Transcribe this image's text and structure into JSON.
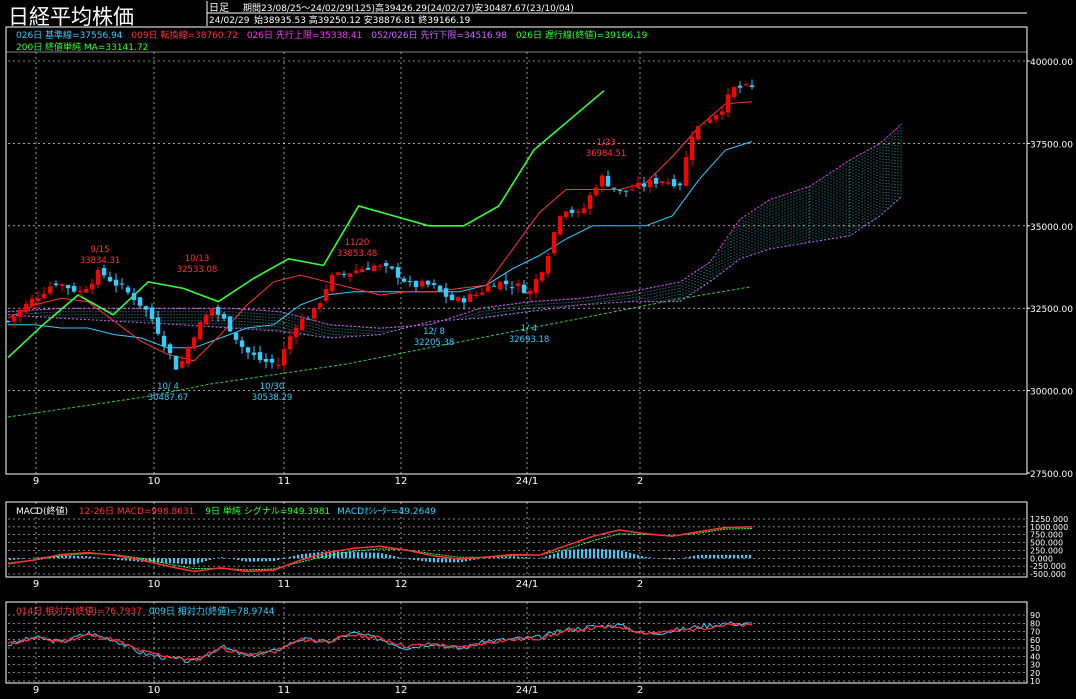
{
  "header": {
    "title": "日経平均株価",
    "mode": "日足",
    "period": "期間23/08/25〜24/02/29(125)高39426.29(24/02/27)安30487.67(23/10/04)",
    "date": "24/02/29",
    "ohlc": "始38935.53 高39250.12 安38876.81 終39166.19"
  },
  "legend_main": {
    "line1": [
      {
        "text": "026日 基準線=37556.94",
        "color": "#33ccff"
      },
      {
        "text": "009日 転換線=38760.72",
        "color": "#ff3333"
      },
      {
        "text": "026日 先行上限=35338.41",
        "color": "#ff33ff"
      },
      {
        "text": "052/026日 先行下限=34516.98",
        "color": "#cc66ff"
      },
      {
        "text": "026日 遅行線(終値)=39166.19",
        "color": "#33ff33"
      }
    ],
    "line2": [
      {
        "text": "200日 終値単純 MA=33141.72",
        "color": "#33ff33"
      }
    ]
  },
  "legend_macd": [
    {
      "text": "MACD(終値)",
      "color": "#ffffff"
    },
    {
      "text": "12-26日 MACD=998.8631",
      "color": "#ff3333"
    },
    {
      "text": "9日 単純 シグナル=949.3981",
      "color": "#33ff33"
    },
    {
      "text": "MACDｵｼﾚｰﾀｰ=49.2649",
      "color": "#33ccff"
    }
  ],
  "legend_rsi": [
    {
      "text": "014日 相対力(終値)=76.7937",
      "color": "#ff3333"
    },
    {
      "text": "009日 相対力(終値)=78.9744",
      "color": "#33ccff"
    }
  ],
  "annotations": [
    {
      "date": "9/15",
      "value": "33834.31",
      "color": "#ff3333"
    },
    {
      "date": "10/13",
      "value": "32533.08",
      "color": "#ff3333"
    },
    {
      "date": "11/20",
      "value": "33853.48",
      "color": "#ff3333"
    },
    {
      "date": "1/23",
      "value": "36984.51",
      "color": "#ff3333"
    },
    {
      "date": "10/ 4",
      "value": "30487.67",
      "color": "#33ccff"
    },
    {
      "date": "10/30",
      "value": "30538.29",
      "color": "#33ccff"
    },
    {
      "date": "12/ 8",
      "value": "32205.38",
      "color": "#33ccff"
    },
    {
      "date": "1/ 4",
      "value": "32693.18",
      "color": "#33ccff"
    }
  ],
  "colors": {
    "up": "#ff0000",
    "down": "#33ccff",
    "kijun": "#33ccff",
    "tenkan": "#ff3333",
    "chikou": "#33ff33",
    "ma200": "#33cc33",
    "cloud": "#cc66ff",
    "cloud_hatch": "#33cccc",
    "grid": "#ffffff",
    "frame": "#ffffff"
  },
  "chart_data": [
    {
      "type": "candlestick",
      "title": "日経平均株価",
      "x_ticks": [
        "9",
        "10",
        "11",
        "12",
        "24/1",
        "2"
      ],
      "y_ticks": [
        "27500.00",
        "30000.00",
        "32500.00",
        "35000.00",
        "37500.00",
        "40000.00"
      ],
      "ylim": [
        27500,
        40500
      ],
      "grid": true,
      "series": [
        {
          "name": "026日 基準線",
          "values": [
            32000,
            32000,
            31900,
            31900,
            31700,
            31600,
            31300,
            31300,
            31600,
            31900,
            32000,
            32600,
            32900,
            33000,
            33000,
            33000,
            33000,
            33000,
            33200,
            33700,
            34100,
            34600,
            35000,
            35000,
            35000,
            35300,
            36400,
            37300,
            37557
          ]
        },
        {
          "name": "009日 転換線",
          "values": [
            32200,
            32600,
            32800,
            32700,
            32100,
            31500,
            31100,
            30900,
            31700,
            32600,
            33300,
            33500,
            33300,
            33100,
            32900,
            33000,
            33000,
            33100,
            33200,
            34300,
            35400,
            36100,
            36100,
            36100,
            36300,
            37100,
            38000,
            38700,
            38761
          ]
        },
        {
          "name": "026日 遅行線(終値)",
          "values": [
            31000,
            32000,
            32900,
            32300,
            33300,
            33100,
            32700,
            33400,
            34000,
            33800,
            35600,
            35300,
            35000,
            35000,
            35600,
            37300,
            38200,
            39100
          ]
        },
        {
          "name": "200日 終値単純 MA",
          "values": [
            29200,
            29500,
            29800,
            30200,
            30500,
            30800,
            31200,
            31600,
            32000,
            32400,
            32800,
            33142
          ]
        }
      ]
    },
    {
      "type": "line",
      "title": "MACD(終値)",
      "y_ticks": [
        "1250.000",
        "1000.000",
        "750.000",
        "500.000",
        "250.000",
        "0.000",
        "-250.000",
        "-500.000"
      ],
      "ylim": [
        -500,
        1250
      ],
      "series": [
        {
          "name": "12-26日 MACD",
          "values": [
            -180,
            -50,
            120,
            180,
            100,
            -50,
            -250,
            -420,
            -300,
            -420,
            -380,
            -60,
            180,
            320,
            380,
            260,
            80,
            -30,
            40,
            120,
            100,
            400,
            700,
            900,
            780,
            700,
            850,
            980,
            999
          ]
        },
        {
          "name": "9日 単純 シグナル",
          "values": [
            -150,
            -60,
            80,
            150,
            120,
            0,
            -180,
            -330,
            -320,
            -370,
            -340,
            -120,
            80,
            230,
            300,
            270,
            140,
            30,
            30,
            90,
            100,
            280,
            560,
            780,
            760,
            720,
            800,
            930,
            949
          ]
        }
      ]
    },
    {
      "type": "line",
      "title": "相対力",
      "y_ticks": [
        "90",
        "80",
        "70",
        "60",
        "50",
        "40",
        "30",
        "20",
        "10"
      ],
      "ylim": [
        10,
        90
      ],
      "series": [
        {
          "name": "014日 相対力(終値)",
          "values": [
            55,
            62,
            58,
            66,
            60,
            46,
            40,
            35,
            50,
            42,
            45,
            60,
            58,
            66,
            62,
            52,
            55,
            50,
            57,
            60,
            62,
            70,
            74,
            76,
            68,
            70,
            74,
            78,
            77
          ]
        },
        {
          "name": "009日 相対力(終値)",
          "values": [
            54,
            63,
            57,
            68,
            60,
            44,
            38,
            33,
            52,
            40,
            46,
            61,
            57,
            68,
            61,
            50,
            56,
            49,
            58,
            61,
            63,
            72,
            76,
            78,
            67,
            71,
            76,
            80,
            79
          ]
        }
      ]
    }
  ]
}
